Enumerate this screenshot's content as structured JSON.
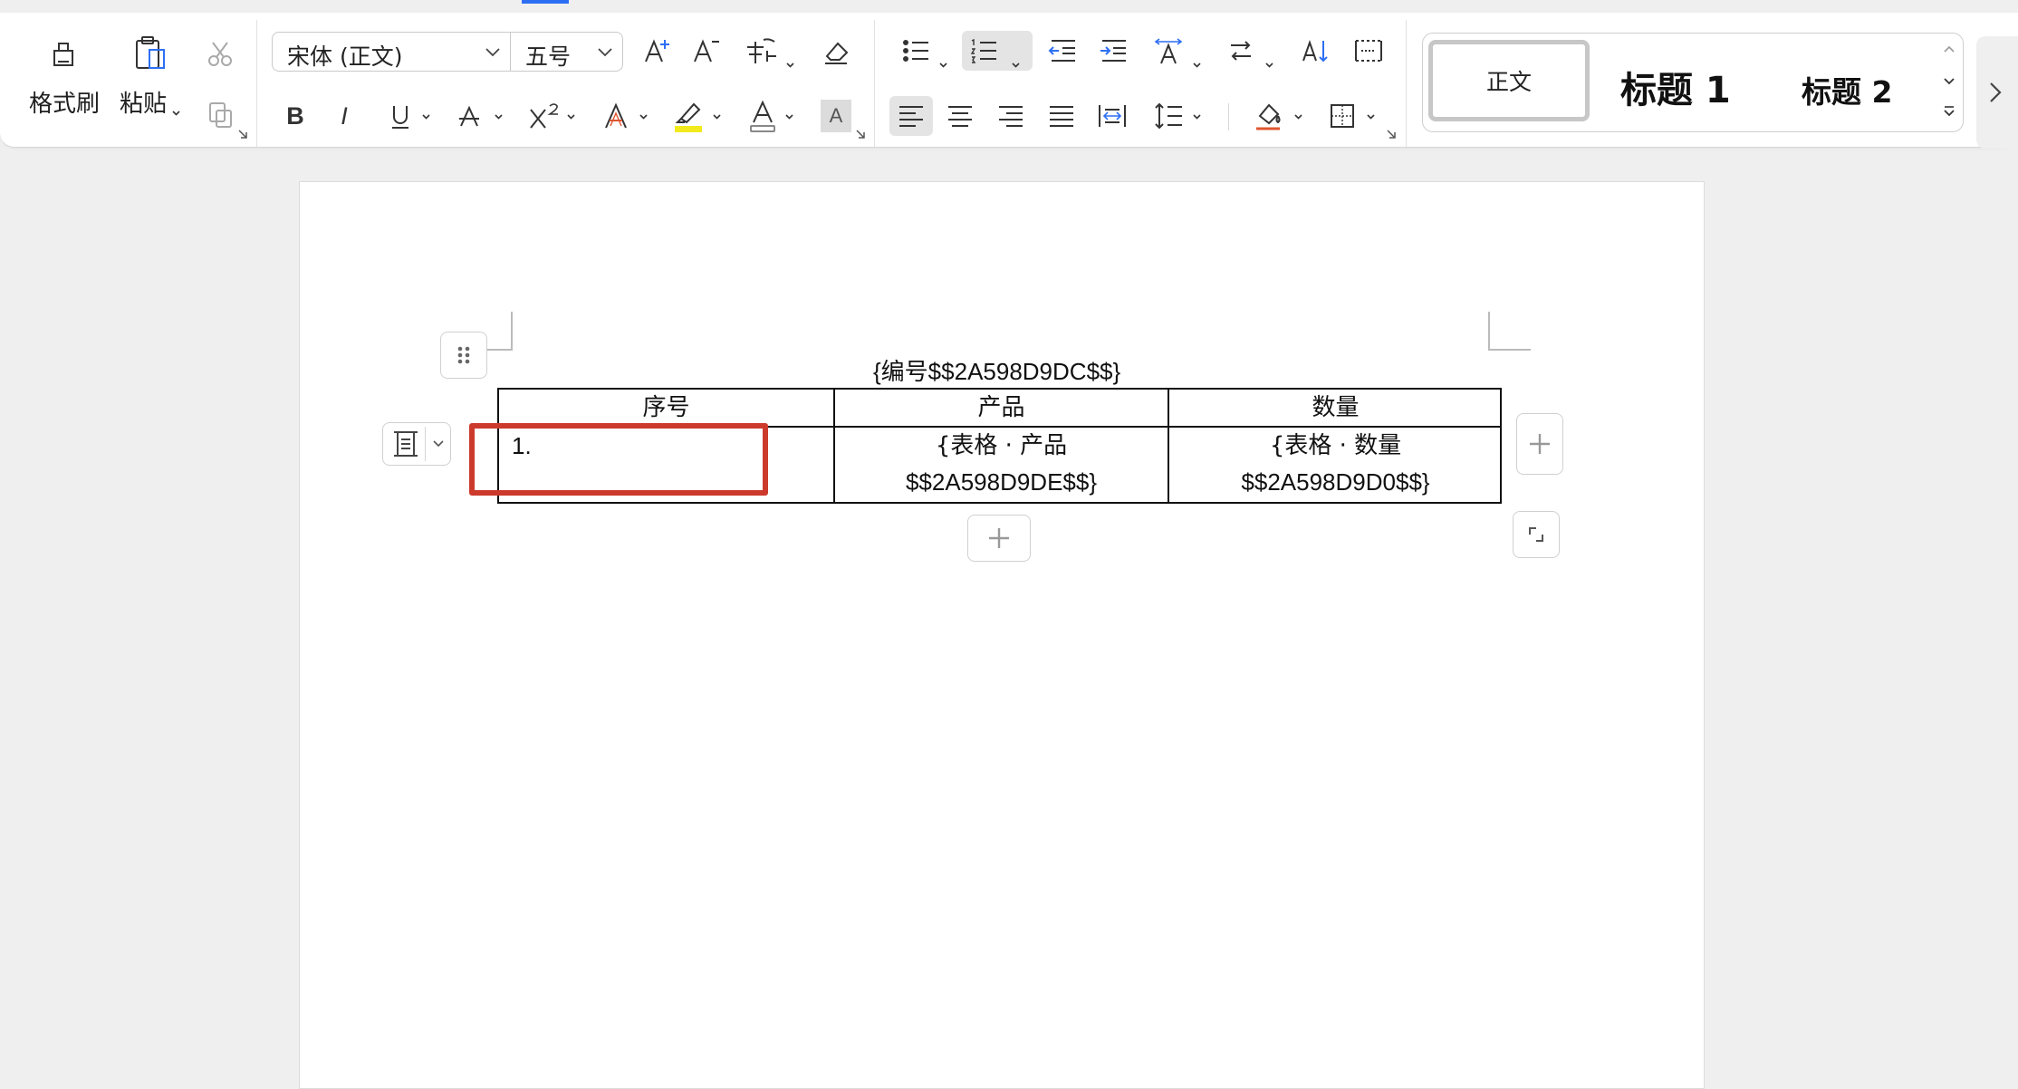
{
  "ribbon": {
    "format_painter_label": "格式刷",
    "paste_label": "粘贴",
    "font_name": "宋体 (正文)",
    "font_size": "五号",
    "styles": {
      "normal": "正文",
      "heading1": "标题  1",
      "heading2": "标题  2"
    }
  },
  "document": {
    "number_field": "{编号$$2A598D9DC$$}",
    "table": {
      "headers": [
        "序号",
        "产品",
        "数量"
      ],
      "rows": [
        {
          "index": "1.",
          "product_line1": "{表格 · 产品",
          "product_line2": "$$2A598D9DE$$}",
          "quantity_line1": "{表格 · 数量",
          "quantity_line2": "$$2A598D9D0$$}"
        }
      ]
    }
  },
  "colors": {
    "accent": "#2d6ff2",
    "highlight_box": "#cc3a2c",
    "highlighter_yellow": "#f2ea1d",
    "text_highlight_red": "#e0552f"
  }
}
